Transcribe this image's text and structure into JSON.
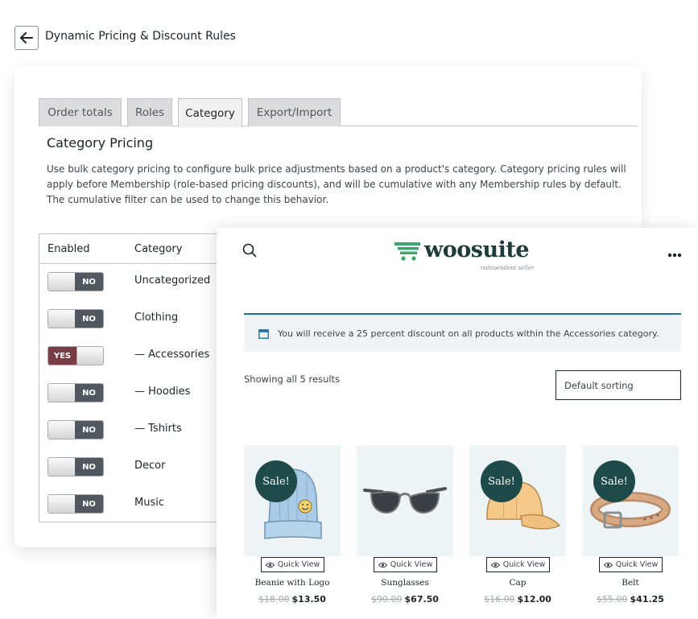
{
  "admin": {
    "title": "Dynamic Pricing & Discount Rules",
    "tabs": [
      {
        "label": "Order totals"
      },
      {
        "label": "Roles"
      },
      {
        "label": "Category"
      },
      {
        "label": "Export/Import"
      }
    ],
    "active_tab": "Category",
    "section_title": "Category Pricing",
    "section_description": "Use bulk category pricing to configure bulk price adjustments based on a product's category. Category pricing rules will apply before Membership (role-based pricing discounts), and will be cumulative with any Membership rules by default. The cumulative filter can be used to change this behavior.",
    "table": {
      "headers": {
        "enabled": "Enabled",
        "category": "Category"
      },
      "rows": [
        {
          "state": "NO",
          "enabled": false,
          "category": "Uncategorized"
        },
        {
          "state": "NO",
          "enabled": false,
          "category": "Clothing"
        },
        {
          "state": "YES",
          "enabled": true,
          "category": "— Accessories"
        },
        {
          "state": "NO",
          "enabled": false,
          "category": "— Hoodies"
        },
        {
          "state": "NO",
          "enabled": false,
          "category": "— Tshirts"
        },
        {
          "state": "NO",
          "enabled": false,
          "category": "Decor"
        },
        {
          "state": "NO",
          "enabled": false,
          "category": "Music"
        }
      ]
    }
  },
  "store": {
    "brand": {
      "name": "woosuite",
      "tagline": "independent seller",
      "accent": "#3aa76d"
    },
    "notice": "You will receive a 25 percent discount on all products within the Accessories category.",
    "result_count": "Showing all 5 results",
    "sort": {
      "selected": "Default sorting"
    },
    "sale_badge": "Sale!",
    "quick_view_label": "Quick View",
    "products": [
      {
        "name": "Beanie with Logo",
        "old_price": "$18.00",
        "price": "$13.50",
        "on_sale": true,
        "image": "beanie"
      },
      {
        "name": "Sunglasses",
        "old_price": "$90.00",
        "price": "$67.50",
        "on_sale": false,
        "image": "sunglasses"
      },
      {
        "name": "Cap",
        "old_price": "$16.00",
        "price": "$12.00",
        "on_sale": true,
        "image": "cap"
      },
      {
        "name": "Belt",
        "old_price": "$55.00",
        "price": "$41.25",
        "on_sale": true,
        "image": "belt"
      }
    ]
  },
  "colors": {
    "toggle_off": "#50575e",
    "toggle_on": "#7a3c46",
    "sale_badge": "#1f4a4a",
    "notice_border": "#1e6fa8"
  },
  "icons": {
    "back": "arrow-left-icon",
    "search": "search-icon",
    "more": "more-dots-icon",
    "notice": "calendar-icon",
    "quick_view": "eye-icon",
    "brand": "shopping-cart-icon"
  }
}
